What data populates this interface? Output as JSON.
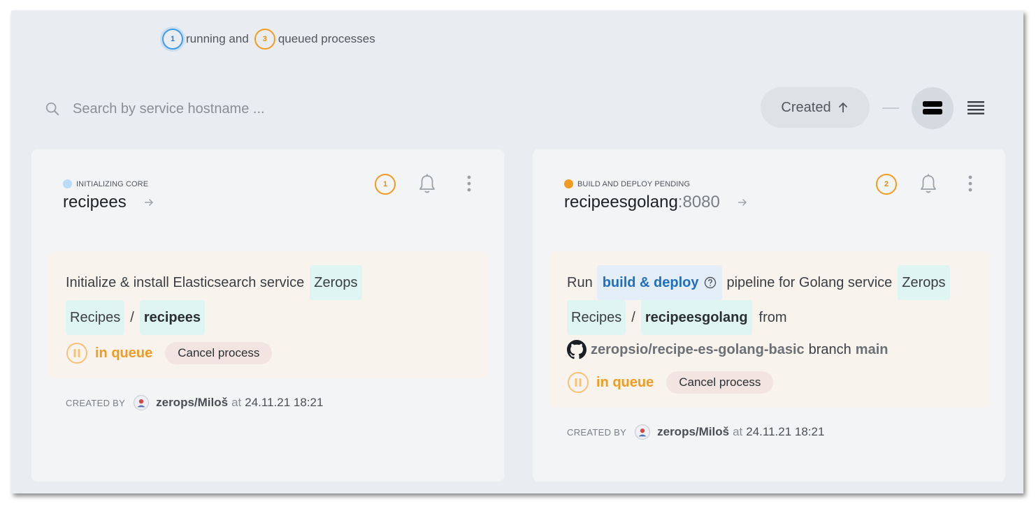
{
  "summary": {
    "running_count": "1",
    "running_text": "running and",
    "queued_count": "3",
    "queued_text": "queued processes"
  },
  "search": {
    "placeholder": "Search by service hostname ..."
  },
  "sort": {
    "label": "Created",
    "direction_icon": "arrow-up-icon"
  },
  "view_modes": [
    "card-view-icon",
    "list-view-icon"
  ],
  "colors": {
    "running": "#3d9bea",
    "queued": "#f29b21",
    "status_initializing": "#b9dcf7",
    "status_pending": "#f29b21"
  },
  "cards": [
    {
      "status": "INITIALIZING CORE",
      "hostname": "recipees",
      "port": "",
      "process_count": "1",
      "process": {
        "text_prefix": "Initialize & install Elasticsearch service",
        "project": "Zerops",
        "project_cont": "Recipes",
        "separator": "/",
        "service": "recipees",
        "state": "in queue",
        "cancel_label": "Cancel process"
      },
      "created_label": "CREATED BY",
      "created_user": "zerops/Miloš",
      "created_at_word": "at",
      "created_time": "24.11.21 18:21"
    },
    {
      "status": "BUILD AND DEPLOY PENDING",
      "hostname": "recipeesgolang",
      "port": ":8080",
      "process_count": "2",
      "process": {
        "text_run": "Run",
        "pipeline_link": "build & deploy",
        "text_pipeline": "pipeline for Golang service",
        "project": "Zerops",
        "project_cont": "Recipes",
        "separator": "/",
        "service": "recipeesgolang",
        "text_from": "from",
        "repo": "zeropsio/recipe-es-golang-basic",
        "branch_word": "branch",
        "branch": "main",
        "state": "in queue",
        "cancel_label": "Cancel process"
      },
      "created_label": "CREATED BY",
      "created_user": "zerops/Miloš",
      "created_at_word": "at",
      "created_time": "24.11.21 18:21"
    }
  ]
}
